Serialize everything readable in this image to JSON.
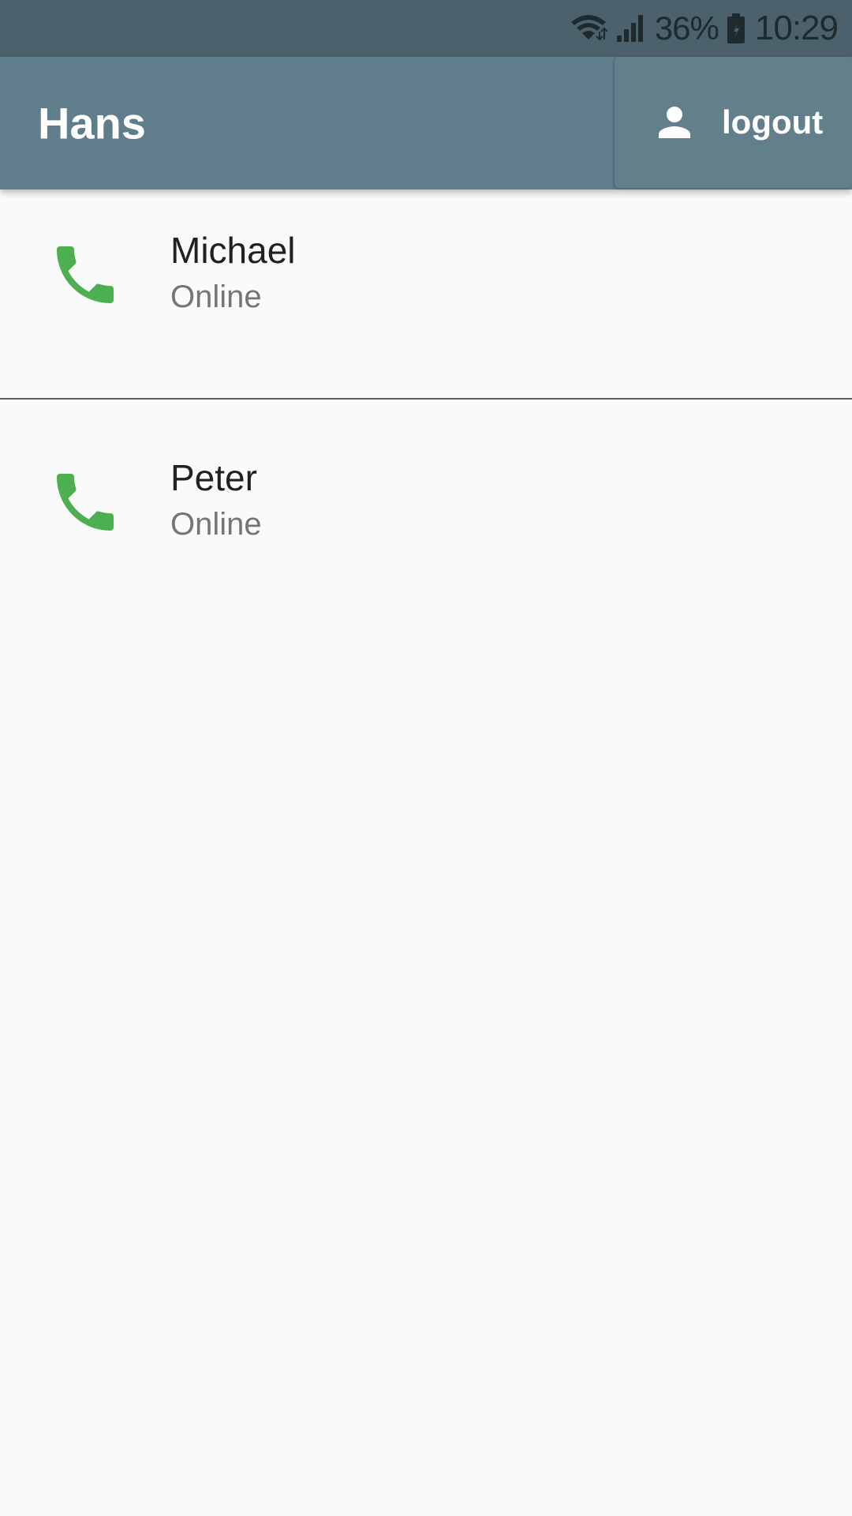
{
  "status_bar": {
    "battery_percent": "36%",
    "time": "10:29",
    "icons": [
      "wifi-icon",
      "signal-icon",
      "battery-icon"
    ]
  },
  "app_bar": {
    "title": "Hans",
    "logout_label": "logout",
    "logout_icon": "person-icon",
    "color": "#607d8b"
  },
  "contacts": [
    {
      "name": "Michael",
      "status": "Online",
      "icon": "phone-icon",
      "icon_color": "#4caf50"
    },
    {
      "name": "Peter",
      "status": "Online",
      "icon": "phone-icon",
      "icon_color": "#4caf50"
    }
  ]
}
